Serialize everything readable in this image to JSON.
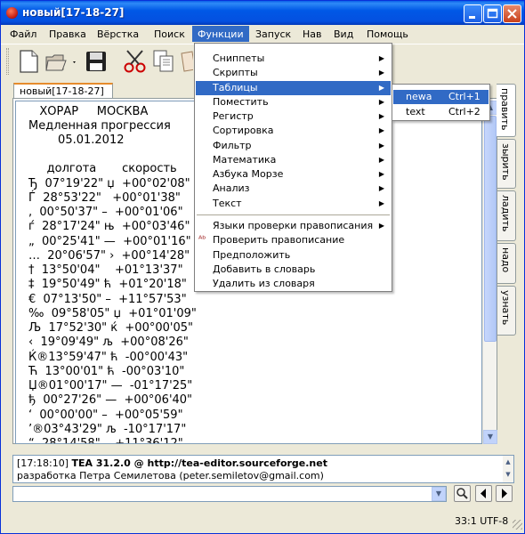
{
  "window": {
    "title": "новый[17-18-27]"
  },
  "menubar": [
    "Файл",
    "Правка",
    "Вёрстка",
    "Поиск",
    "Функции",
    "Запуск",
    "Нав",
    "Вид",
    "Помощь"
  ],
  "toolbar": {
    "icons": [
      "new-file-icon",
      "open-file-icon",
      "save-icon",
      "cut-icon",
      "copy-icon",
      "paste-icon"
    ]
  },
  "tab": {
    "label": "новый[17-18-27]"
  },
  "editor": {
    "lines": [
      "   ХОРАР     МОСКВА",
      "Медленная прогрессия",
      "        05.01.2012",
      "",
      "     долгота       скорость",
      "Ђ  07°19'22\" џ  +00°02'08\"",
      "Ѓ  28°53'22\"   +00°01'38\"",
      ",  00°50'37\" –  +00°01'06\"",
      "ѓ  28°17'24\" њ  +00°03'46\"",
      "„  00°25'41\" —  +00°01'16\"",
      "…  20°06'57\" ›  +00°14'28\"",
      "†  13°50'04\"    +01°13'37\"",
      "‡  19°50'49\" ћ  +01°20'18\"",
      "€  07°13'50\" –  +11°57'53\"",
      "‰  09°58'05\" џ  +01°01'09\"",
      "Љ  17°52'30\" ќ  +00°00'05\"",
      "‹  19°09'49\" љ  +00°08'26\"",
      "Ќ®13°59'47\" ћ  -00°00'43\"",
      "Ћ  13°00'01\" ћ  -00°03'10\"",
      "Џ®01°00'17\" —  -01°17'25\"",
      "ђ  00°27'26\" —  +00°06'40\"",
      "‘  00°00'00\" –  +00°05'59\"",
      "’®03°43'29\" љ  -10°17'17\"",
      "“  28°14'58\" ‚  +11°36'12\""
    ]
  },
  "side_tabs": [
    "править",
    "зырить",
    "ладить",
    "надо",
    "узнать"
  ],
  "menu": {
    "items": [
      {
        "label": "Сниппеты",
        "submenu": true
      },
      {
        "label": "Скрипты",
        "submenu": true
      },
      {
        "label": "Таблицы",
        "submenu": true,
        "highlighted": true
      },
      {
        "label": "Поместить",
        "submenu": true
      },
      {
        "label": "Регистр",
        "submenu": true
      },
      {
        "label": "Сортировка",
        "submenu": true
      },
      {
        "label": "Фильтр",
        "submenu": true
      },
      {
        "label": "Математика",
        "submenu": true
      },
      {
        "label": "Азбука Морзе",
        "submenu": true
      },
      {
        "label": "Анализ",
        "submenu": true
      },
      {
        "label": "Текст",
        "submenu": true
      },
      {
        "separator": true
      },
      {
        "label": "Языки проверки правописания",
        "submenu": true
      },
      {
        "label": "Проверить правописание",
        "icon": "spellcheck-icon"
      },
      {
        "label": "Предположить"
      },
      {
        "label": "Добавить в словарь"
      },
      {
        "label": "Удалить из словаря"
      }
    ]
  },
  "submenu": {
    "items": [
      {
        "label": "newa",
        "shortcut": "Ctrl+1",
        "highlighted": true
      },
      {
        "label": "text",
        "shortcut": "Ctrl+2"
      }
    ]
  },
  "log": {
    "line1_time": "[17:18:10]",
    "line1_text": "TEA 31.2.0 @ http://tea-editor.sourceforge.net",
    "line2_text": "разработка Петра Семилетова (peter.semiletov@gmail.com)"
  },
  "status": {
    "position": "33:1 UTF-8"
  },
  "colors": {
    "highlight": "#316ac5",
    "titlebar": "#0058e6",
    "tab_accent": "#e68b2c"
  }
}
